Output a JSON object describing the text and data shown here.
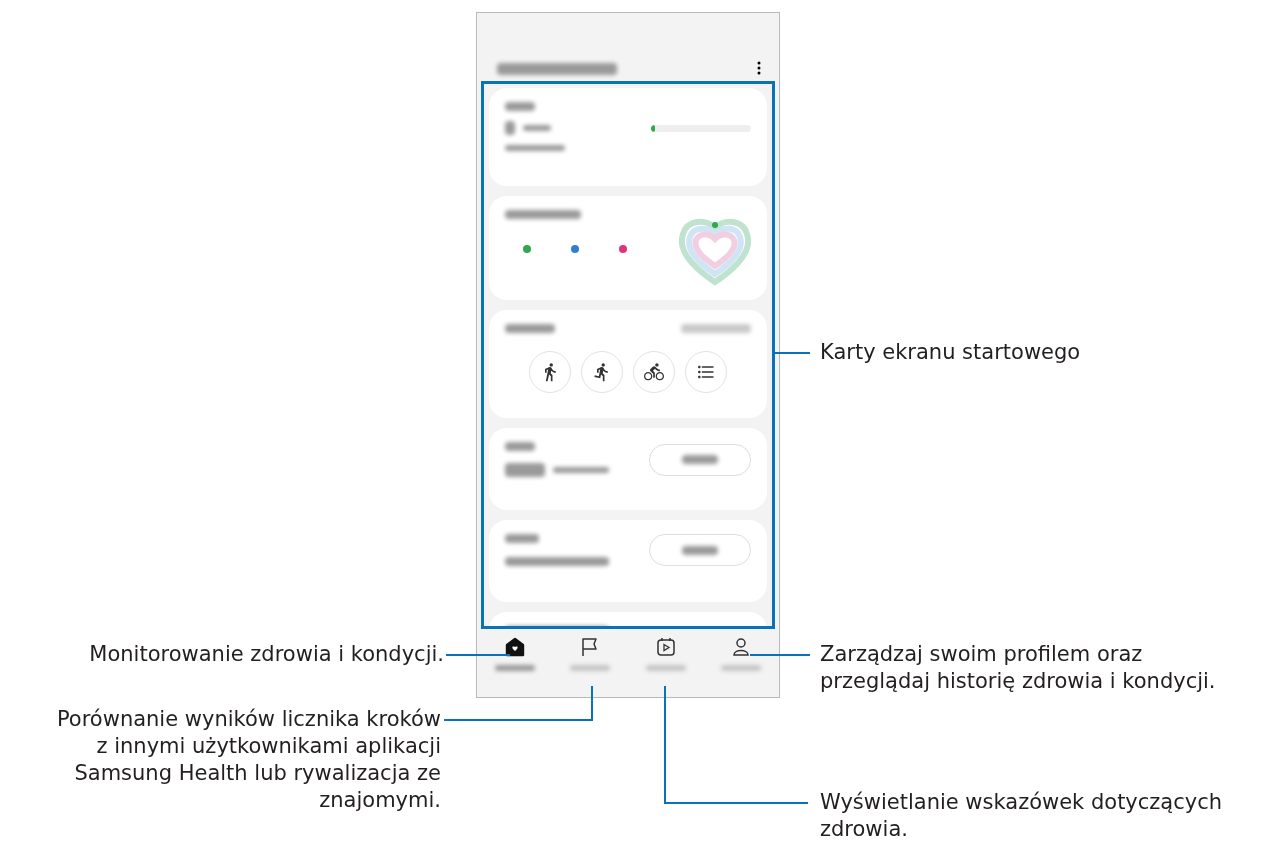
{
  "phone": {
    "steps_card": {
      "level": 0.03
    },
    "nav_tabs": [
      {
        "kind": "home",
        "selected": true
      },
      {
        "kind": "together",
        "selected": false
      },
      {
        "kind": "fitness",
        "selected": false
      },
      {
        "kind": "profile",
        "selected": false
      }
    ]
  },
  "callouts": [
    {
      "lines": [
        "Karty ekranu startowego"
      ]
    },
    {
      "lines": [
        "Monitorowanie zdrowia i kondycji."
      ]
    },
    {
      "lines": [
        "Zarządzaj swoim profilem oraz",
        "przeglądaj historię zdrowia i kondycji."
      ]
    },
    {
      "lines": [
        "Porównanie wyników licznika kroków",
        "z innymi użytkownikami aplikacji",
        "Samsung Health lub rywalizacja ze",
        "znajomymi."
      ]
    },
    {
      "lines": [
        "Wyświetlanie wskazówek dotyczących",
        "zdrowia."
      ]
    }
  ]
}
